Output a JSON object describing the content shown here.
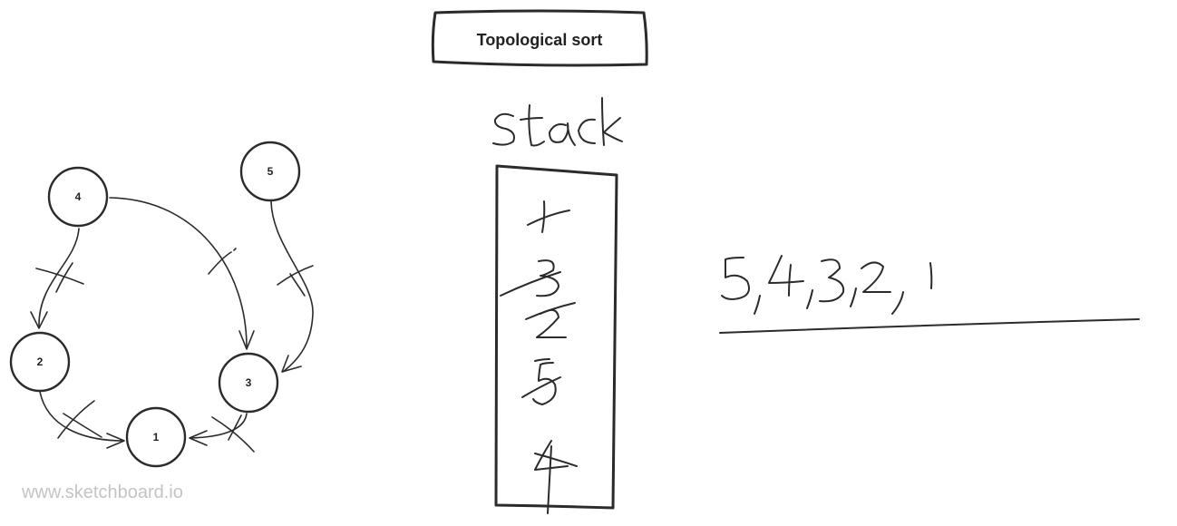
{
  "title": "Topological sort",
  "stack_label": "stack",
  "nodes": [
    {
      "id": "4",
      "label": "4"
    },
    {
      "id": "5",
      "label": "5"
    },
    {
      "id": "2",
      "label": "2"
    },
    {
      "id": "3",
      "label": "3"
    },
    {
      "id": "1",
      "label": "1"
    }
  ],
  "edges": [
    {
      "from": "4",
      "to": "2",
      "crossed": true
    },
    {
      "from": "4",
      "to": "3",
      "crossed": true
    },
    {
      "from": "5",
      "to": "3",
      "crossed": true
    },
    {
      "from": "2",
      "to": "1",
      "crossed": true
    },
    {
      "from": "3",
      "to": "1",
      "crossed": true
    }
  ],
  "stack_items_top_to_bottom": [
    "1",
    "3",
    "2",
    "5",
    "4"
  ],
  "stack_items_crossed_out": true,
  "result_order": "5,4,3,2,1",
  "watermark": "www.sketchboard.io"
}
